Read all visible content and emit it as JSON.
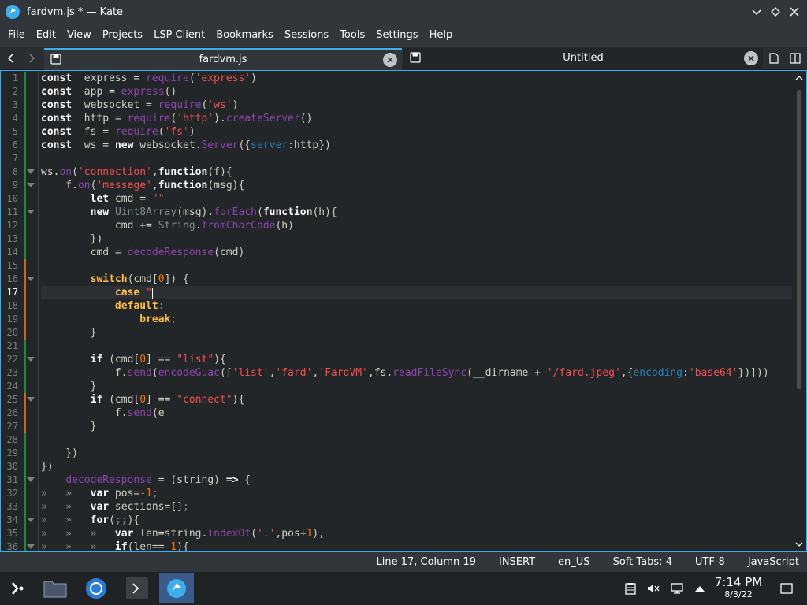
{
  "window": {
    "title": "fardvm.js * — Kate"
  },
  "menu": [
    "File",
    "Edit",
    "View",
    "Projects",
    "LSP Client",
    "Bookmarks",
    "Sessions",
    "Tools",
    "Settings",
    "Help"
  ],
  "tabs": [
    {
      "label": "fardvm.js",
      "active": true
    },
    {
      "label": "Untitled",
      "active": false
    }
  ],
  "editor": {
    "current_line": 17,
    "lines": [
      {
        "n": "1",
        "fold": false,
        "mark": "saved",
        "tokens": [
          [
            "k",
            "const"
          ],
          [
            "",
            "  express = "
          ],
          [
            "f",
            "require"
          ],
          [
            "",
            "("
          ],
          [
            "s",
            "'express'"
          ],
          [
            "",
            ")"
          ]
        ]
      },
      {
        "n": "2",
        "fold": false,
        "mark": "saved",
        "tokens": [
          [
            "k",
            "const"
          ],
          [
            "",
            "  app = "
          ],
          [
            "f",
            "express"
          ],
          [
            "",
            "()"
          ]
        ]
      },
      {
        "n": "3",
        "fold": false,
        "mark": "saved",
        "tokens": [
          [
            "k",
            "const"
          ],
          [
            "",
            "  websocket = "
          ],
          [
            "f",
            "require"
          ],
          [
            "",
            "("
          ],
          [
            "s",
            "'ws'"
          ],
          [
            "",
            ")"
          ]
        ]
      },
      {
        "n": "4",
        "fold": false,
        "mark": "saved",
        "tokens": [
          [
            "k",
            "const"
          ],
          [
            "",
            "  http = "
          ],
          [
            "f",
            "require"
          ],
          [
            "",
            "("
          ],
          [
            "s",
            "'http'"
          ],
          [
            "",
            ")."
          ],
          [
            "f",
            "createServer"
          ],
          [
            "",
            "()"
          ]
        ]
      },
      {
        "n": "5",
        "fold": false,
        "mark": "saved",
        "tokens": [
          [
            "k",
            "const"
          ],
          [
            "",
            "  fs = "
          ],
          [
            "f",
            "require"
          ],
          [
            "",
            "("
          ],
          [
            "s",
            "'fs'"
          ],
          [
            "",
            ")"
          ]
        ]
      },
      {
        "n": "6",
        "fold": false,
        "mark": "saved",
        "tokens": [
          [
            "k",
            "const"
          ],
          [
            "",
            "  ws = "
          ],
          [
            "k",
            "new"
          ],
          [
            "",
            " websocket."
          ],
          [
            "f",
            "Server"
          ],
          [
            "",
            "({"
          ],
          [
            "b",
            "server"
          ],
          [
            "",
            ":http})"
          ]
        ]
      },
      {
        "n": "7",
        "fold": false,
        "mark": "saved",
        "tokens": []
      },
      {
        "n": "8",
        "fold": true,
        "mark": "saved",
        "tokens": [
          [
            "",
            "ws."
          ],
          [
            "f",
            "on"
          ],
          [
            "",
            "("
          ],
          [
            "s",
            "'connection'"
          ],
          [
            "",
            ","
          ],
          [
            "k",
            "function"
          ],
          [
            "",
            "(f){"
          ]
        ]
      },
      {
        "n": "9",
        "fold": true,
        "mark": "saved",
        "tokens": [
          [
            "",
            "    f."
          ],
          [
            "f",
            "on"
          ],
          [
            "",
            "("
          ],
          [
            "s",
            "'message'"
          ],
          [
            "",
            ","
          ],
          [
            "k",
            "function"
          ],
          [
            "",
            "(msg){"
          ]
        ]
      },
      {
        "n": "10",
        "fold": false,
        "mark": "saved",
        "tokens": [
          [
            "",
            "        "
          ],
          [
            "k",
            "let"
          ],
          [
            "",
            " cmd = "
          ],
          [
            "s",
            "\"\""
          ]
        ]
      },
      {
        "n": "11",
        "fold": true,
        "mark": "saved",
        "tokens": [
          [
            "",
            "        "
          ],
          [
            "k",
            "new"
          ],
          [
            "",
            " "
          ],
          [
            "c",
            "Uint8Array"
          ],
          [
            "",
            "(msg)."
          ],
          [
            "f",
            "forEach"
          ],
          [
            "",
            "("
          ],
          [
            "k",
            "function"
          ],
          [
            "",
            "(h){"
          ]
        ]
      },
      {
        "n": "12",
        "fold": false,
        "mark": "saved",
        "tokens": [
          [
            "",
            "            cmd += "
          ],
          [
            "c",
            "String"
          ],
          [
            "",
            "."
          ],
          [
            "f",
            "fromCharCode"
          ],
          [
            "",
            "(h)"
          ]
        ]
      },
      {
        "n": "13",
        "fold": false,
        "mark": "saved",
        "tokens": [
          [
            "",
            "        })"
          ]
        ]
      },
      {
        "n": "14",
        "fold": false,
        "mark": "saved",
        "tokens": [
          [
            "",
            "        cmd = "
          ],
          [
            "f",
            "decodeResponse"
          ],
          [
            "",
            "(cmd)"
          ]
        ]
      },
      {
        "n": "15",
        "fold": false,
        "mark": "modified",
        "tokens": []
      },
      {
        "n": "16",
        "fold": true,
        "mark": "modified",
        "tokens": [
          [
            "",
            "        "
          ],
          [
            "y",
            "switch"
          ],
          [
            "",
            "(cmd["
          ],
          [
            "n",
            "0"
          ],
          [
            "",
            "]) {"
          ]
        ]
      },
      {
        "n": "17",
        "fold": false,
        "mark": "modified",
        "tokens": [
          [
            "",
            "            "
          ],
          [
            "y",
            "case"
          ],
          [
            "",
            " "
          ],
          [
            "s",
            "\""
          ]
        ],
        "cursor": true
      },
      {
        "n": "18",
        "fold": false,
        "mark": "modified",
        "tokens": [
          [
            "",
            "            "
          ],
          [
            "y",
            "default"
          ],
          [
            "c",
            ":"
          ]
        ]
      },
      {
        "n": "19",
        "fold": false,
        "mark": "modified",
        "tokens": [
          [
            "",
            "                "
          ],
          [
            "y",
            "break"
          ],
          [
            "c",
            ";"
          ]
        ]
      },
      {
        "n": "20",
        "fold": false,
        "mark": "modified",
        "tokens": [
          [
            "",
            "        }"
          ]
        ]
      },
      {
        "n": "21",
        "fold": false,
        "mark": "saved",
        "tokens": []
      },
      {
        "n": "22",
        "fold": true,
        "mark": "saved",
        "tokens": [
          [
            "",
            "        "
          ],
          [
            "k",
            "if"
          ],
          [
            "",
            " (cmd["
          ],
          [
            "n",
            "0"
          ],
          [
            "",
            "] == "
          ],
          [
            "s",
            "\"list\""
          ],
          [
            "",
            "){"
          ]
        ]
      },
      {
        "n": "23",
        "fold": false,
        "mark": "saved",
        "tokens": [
          [
            "",
            "            f."
          ],
          [
            "f",
            "send"
          ],
          [
            "",
            "("
          ],
          [
            "f",
            "encodeGuac"
          ],
          [
            "",
            "(["
          ],
          [
            "s",
            "'list'"
          ],
          [
            "",
            ","
          ],
          [
            "s",
            "'fard'"
          ],
          [
            "",
            ","
          ],
          [
            "s",
            "'FardVM'"
          ],
          [
            "",
            ",fs."
          ],
          [
            "f",
            "readFileSync"
          ],
          [
            "",
            "(__dirname + "
          ],
          [
            "s",
            "'/fard.jpeg'"
          ],
          [
            "",
            ",{"
          ],
          [
            "b",
            "encoding"
          ],
          [
            "",
            ":"
          ],
          [
            "s",
            "'base64'"
          ],
          [
            "",
            "})]))"
          ]
        ]
      },
      {
        "n": "24",
        "fold": false,
        "mark": "saved",
        "tokens": [
          [
            "",
            "        }"
          ]
        ]
      },
      {
        "n": "25",
        "fold": true,
        "mark": "modified",
        "tokens": [
          [
            "",
            "        "
          ],
          [
            "k",
            "if"
          ],
          [
            "",
            " (cmd["
          ],
          [
            "n",
            "0"
          ],
          [
            "",
            "] == "
          ],
          [
            "s",
            "\"connect\""
          ],
          [
            "",
            "){"
          ]
        ]
      },
      {
        "n": "26",
        "fold": false,
        "mark": "modified",
        "tokens": [
          [
            "",
            "            f."
          ],
          [
            "f",
            "send"
          ],
          [
            "",
            "(e"
          ]
        ]
      },
      {
        "n": "27",
        "fold": false,
        "mark": "modified",
        "tokens": [
          [
            "",
            "        }"
          ]
        ]
      },
      {
        "n": "28",
        "fold": false,
        "mark": "saved",
        "tokens": []
      },
      {
        "n": "29",
        "fold": false,
        "mark": "saved",
        "tokens": [
          [
            "",
            "    })"
          ]
        ]
      },
      {
        "n": "30",
        "fold": false,
        "mark": "saved",
        "tokens": [
          [
            "",
            "})"
          ]
        ]
      },
      {
        "n": "31",
        "fold": true,
        "mark": "saved",
        "tokens": [
          [
            "",
            "    "
          ],
          [
            "f",
            "decodeResponse"
          ],
          [
            "",
            " = (string) "
          ],
          [
            "k",
            "=>"
          ],
          [
            "",
            " {"
          ]
        ]
      },
      {
        "n": "32",
        "fold": false,
        "mark": "saved",
        "tokens": [
          [
            "c",
            "»   »   "
          ],
          [
            "k",
            "var"
          ],
          [
            "",
            " pos="
          ],
          [
            "n",
            "-1"
          ],
          [
            "c",
            ";"
          ]
        ]
      },
      {
        "n": "33",
        "fold": false,
        "mark": "saved",
        "tokens": [
          [
            "c",
            "»   »   "
          ],
          [
            "k",
            "var"
          ],
          [
            "",
            " sections=[]"
          ],
          [
            "c",
            ";"
          ]
        ]
      },
      {
        "n": "34",
        "fold": true,
        "mark": "saved",
        "tokens": [
          [
            "c",
            "»   »   "
          ],
          [
            "k",
            "for"
          ],
          [
            "",
            "("
          ],
          [
            "c",
            ";;"
          ],
          [
            "",
            "){"
          ]
        ]
      },
      {
        "n": "35",
        "fold": false,
        "mark": "saved",
        "tokens": [
          [
            "c",
            "»   »   »   "
          ],
          [
            "k",
            "var"
          ],
          [
            "",
            " len=string."
          ],
          [
            "f",
            "indexOf"
          ],
          [
            "",
            "("
          ],
          [
            "s",
            "'.'"
          ],
          [
            "",
            ",pos+"
          ],
          [
            "n",
            "1"
          ],
          [
            "",
            "),"
          ]
        ]
      },
      {
        "n": "36",
        "fold": true,
        "mark": "saved",
        "tokens": [
          [
            "c",
            "»   »   »   "
          ],
          [
            "k",
            "if"
          ],
          [
            "",
            "(len=="
          ],
          [
            "n",
            "-1"
          ],
          [
            "",
            "){"
          ]
        ]
      }
    ]
  },
  "status": {
    "position": "Line 17, Column 19",
    "mode": "INSERT",
    "language_dict": "en_US",
    "indent": "Soft Tabs: 4",
    "encoding": "UTF-8",
    "syntax": "JavaScript"
  },
  "clock": {
    "time": "7:14 PM",
    "date": "8/3/22"
  }
}
